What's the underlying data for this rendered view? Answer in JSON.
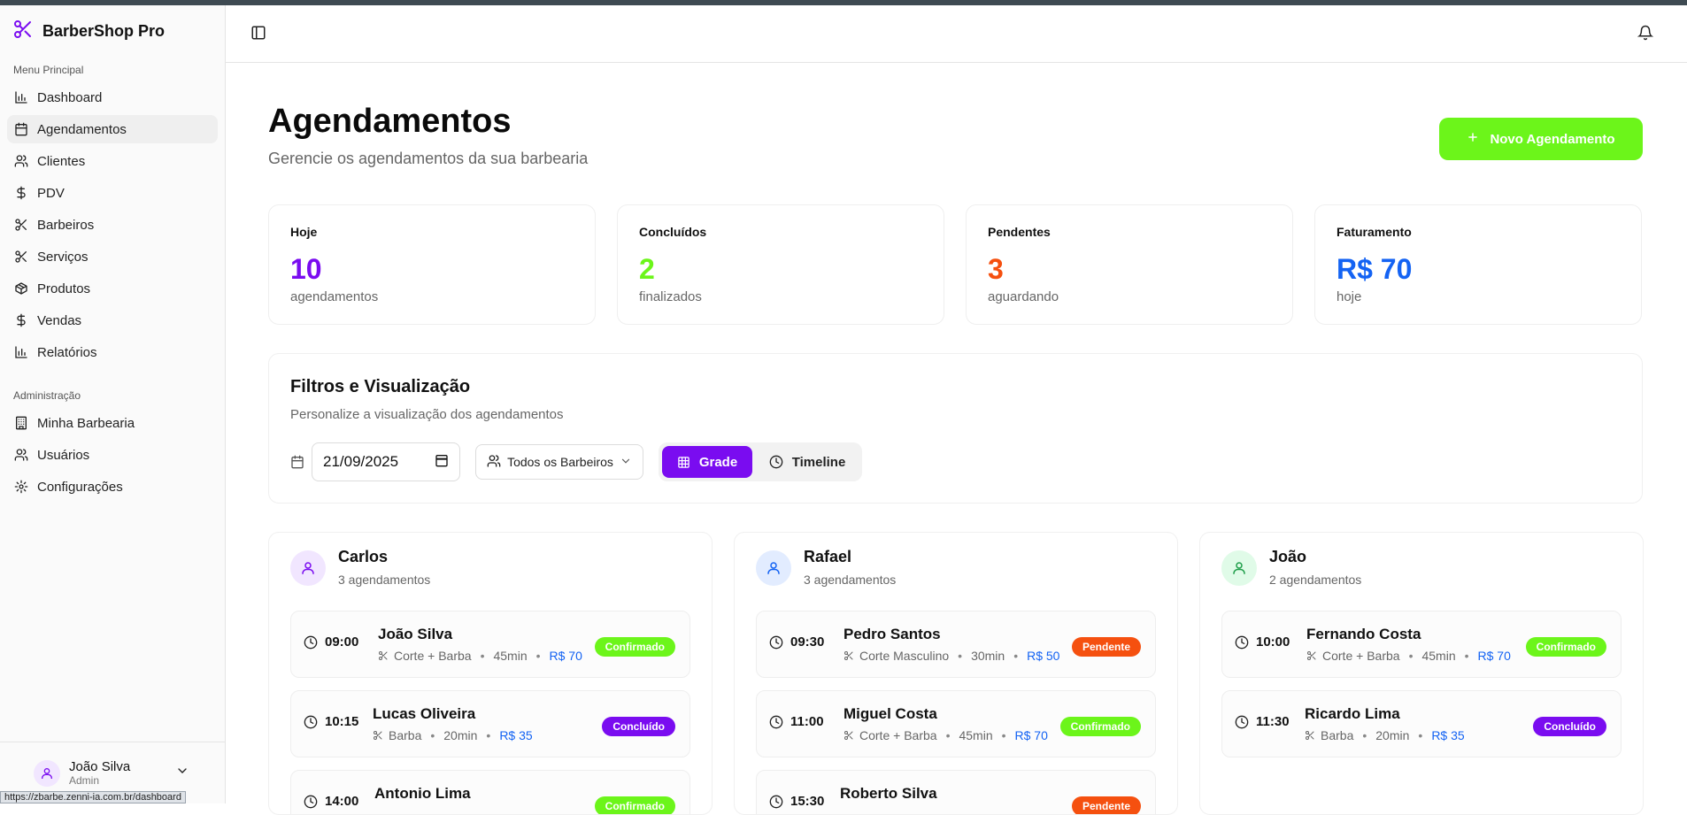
{
  "app": {
    "name": "BarberShop Pro",
    "status_url": "https://zbarbe.zenni-ia.com.br/dashboard"
  },
  "sidebar": {
    "main_group": "Menu Principal",
    "items": [
      {
        "label": "Dashboard",
        "icon": "bar-chart-icon"
      },
      {
        "label": "Agendamentos",
        "icon": "calendar-icon"
      },
      {
        "label": "Clientes",
        "icon": "users-icon"
      },
      {
        "label": "PDV",
        "icon": "dollar-icon"
      },
      {
        "label": "Barbeiros",
        "icon": "scissors-icon"
      },
      {
        "label": "Serviços",
        "icon": "scissors-icon"
      },
      {
        "label": "Produtos",
        "icon": "package-icon"
      },
      {
        "label": "Vendas",
        "icon": "dollar-icon"
      },
      {
        "label": "Relatórios",
        "icon": "bar-chart-icon"
      }
    ],
    "admin_group": "Administração",
    "admin_items": [
      {
        "label": "Minha Barbearia",
        "icon": "building-icon"
      },
      {
        "label": "Usuários",
        "icon": "users-icon"
      },
      {
        "label": "Configurações",
        "icon": "gear-icon"
      }
    ],
    "user": {
      "name": "João Silva",
      "role": "Admin"
    }
  },
  "page": {
    "title": "Agendamentos",
    "subtitle": "Gerencie os agendamentos da sua barbearia",
    "new_button": "Novo Agendamento"
  },
  "stats": [
    {
      "label": "Hoje",
      "value": "10",
      "caption": "agendamentos",
      "color": "#7a0cf0"
    },
    {
      "label": "Concluídos",
      "value": "2",
      "caption": "finalizados",
      "color": "#6cf51a"
    },
    {
      "label": "Pendentes",
      "value": "3",
      "caption": "aguardando",
      "color": "#f5500f"
    },
    {
      "label": "Faturamento",
      "value": "R$ 70",
      "caption": "hoje",
      "color": "#1463f3"
    }
  ],
  "filters": {
    "title": "Filtros e Visualização",
    "subtitle": "Personalize a visualização dos agendamentos",
    "date": "21/09/2025",
    "barber_select": "Todos os Barbeiros",
    "view_grid": "Grade",
    "view_timeline": "Timeline"
  },
  "barbers": [
    {
      "name": "Carlos",
      "count": "3 agendamentos",
      "appointments": [
        {
          "time": "09:00",
          "client": "João Silva",
          "service": "Corte + Barba",
          "duration": "45min",
          "price": "R$ 70",
          "status": "Confirmado"
        },
        {
          "time": "10:15",
          "client": "Lucas Oliveira",
          "service": "Barba",
          "duration": "20min",
          "price": "R$ 35",
          "status": "Concluído"
        },
        {
          "time": "14:00",
          "client": "Antonio Lima",
          "service": "",
          "duration": "",
          "price": "",
          "status": "Confirmado"
        }
      ]
    },
    {
      "name": "Rafael",
      "count": "3 agendamentos",
      "appointments": [
        {
          "time": "09:30",
          "client": "Pedro Santos",
          "service": "Corte Masculino",
          "duration": "30min",
          "price": "R$ 50",
          "status": "Pendente"
        },
        {
          "time": "11:00",
          "client": "Miguel Costa",
          "service": "Corte + Barba",
          "duration": "45min",
          "price": "R$ 70",
          "status": "Confirmado"
        },
        {
          "time": "15:30",
          "client": "Roberto Silva",
          "service": "",
          "duration": "",
          "price": "",
          "status": "Pendente"
        }
      ]
    },
    {
      "name": "João",
      "count": "2 agendamentos",
      "appointments": [
        {
          "time": "10:00",
          "client": "Fernando Costa",
          "service": "Corte + Barba",
          "duration": "45min",
          "price": "R$ 70",
          "status": "Confirmado"
        },
        {
          "time": "11:30",
          "client": "Ricardo Lima",
          "service": "Barba",
          "duration": "20min",
          "price": "R$ 35",
          "status": "Concluído"
        }
      ]
    }
  ],
  "status_colors": {
    "Confirmado": "#6cf51a",
    "Concluído": "#7a0cf0",
    "Pendente": "#f5500f"
  }
}
